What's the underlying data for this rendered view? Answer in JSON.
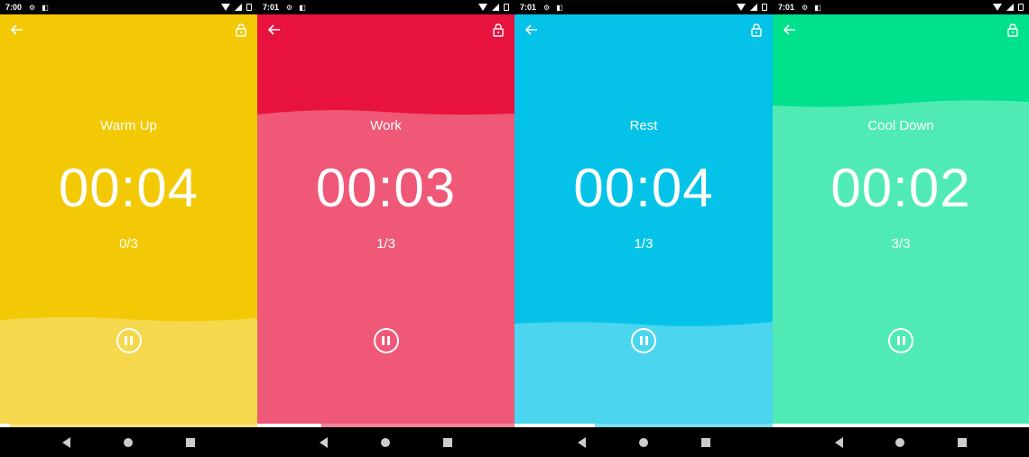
{
  "screens": [
    {
      "status_time": "7:00",
      "phase": "Warm Up",
      "timer": "00:04",
      "round": "0/3",
      "bg_color": "#F2C904",
      "fill_color": "#F6D84E",
      "fill_fraction": 0.25,
      "progress_fraction": 0.04,
      "icons": [
        "back-arrow-icon",
        "lock-icon",
        "pause-icon"
      ]
    },
    {
      "status_time": "7:01",
      "phase": "Work",
      "timer": "00:03",
      "round": "1/3",
      "bg_color": "#E8123E",
      "fill_color": "#EF5877",
      "fill_fraction": 0.75,
      "progress_fraction": 0.25,
      "icons": [
        "back-arrow-icon",
        "lock-icon",
        "pause-icon"
      ]
    },
    {
      "status_time": "7:01",
      "phase": "Rest",
      "timer": "00:04",
      "round": "1/3",
      "bg_color": "#05C3E8",
      "fill_color": "#4CD5EE",
      "fill_fraction": 0.24,
      "progress_fraction": 0.31,
      "icons": [
        "back-arrow-icon",
        "lock-icon",
        "pause-icon"
      ]
    },
    {
      "status_time": "7:01",
      "phase": "Cool Down",
      "timer": "00:02",
      "round": "3/3",
      "bg_color": "#00E18E",
      "fill_color": "#50EBB4",
      "fill_fraction": 0.77,
      "progress_fraction": 1.0,
      "icons": [
        "back-arrow-icon",
        "lock-icon",
        "pause-icon"
      ]
    }
  ]
}
